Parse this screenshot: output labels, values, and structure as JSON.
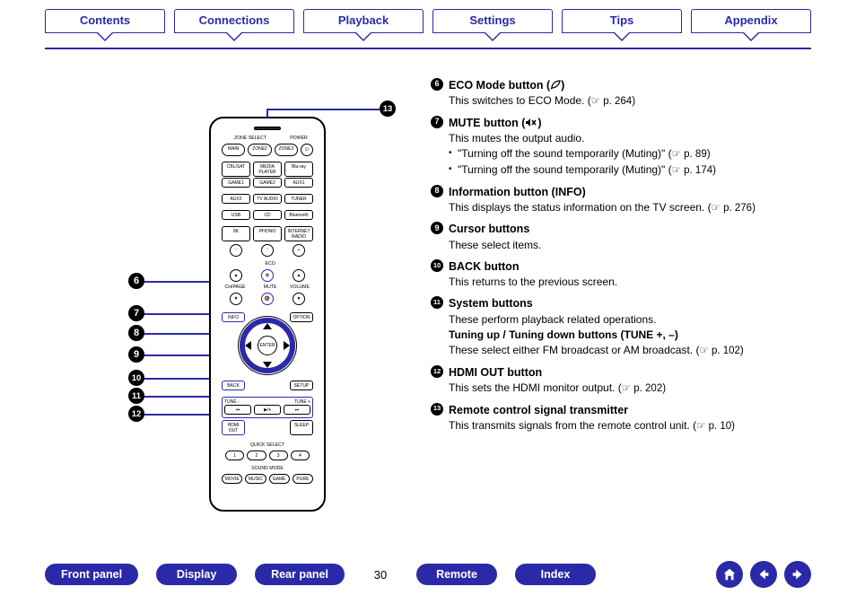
{
  "top_tabs": [
    "Contents",
    "Connections",
    "Playback",
    "Settings",
    "Tips",
    "Appendix"
  ],
  "page_number": "30",
  "callouts": {
    "n6": "6",
    "n7": "7",
    "n8": "8",
    "n9": "9",
    "n10": "10",
    "n11": "11",
    "n12": "12",
    "n13": "13"
  },
  "items": {
    "i6": {
      "title": "ECO Mode button (",
      "title_suffix": ")",
      "desc": "This switches to ECO Mode.  (",
      "pref": " p. 264)",
      "icon": "leaf"
    },
    "i7": {
      "title": "MUTE button (",
      "title_suffix": ")",
      "desc": "This mutes the output audio.",
      "sub1": "\"Turning off the sound temporarily (Muting)\" (",
      "pref1": " p. 89)",
      "sub2": "\"Turning off the sound temporarily (Muting)\" (",
      "pref2": " p. 174)",
      "icon": "mute"
    },
    "i8": {
      "title": "Information button (INFO)",
      "desc": "This displays the status information on the TV screen.  (",
      "pref": " p. 276)"
    },
    "i9": {
      "title": "Cursor buttons",
      "desc": "These select items."
    },
    "i10": {
      "title": "BACK button",
      "desc": "This returns to the previous screen."
    },
    "i11": {
      "title": "System buttons",
      "desc": "These perform playback related operations.",
      "sub_bold": "Tuning up / Tuning down buttons (TUNE +, –)",
      "sub_desc": "These select either FM broadcast or AM broadcast.  (",
      "pref": " p. 102)"
    },
    "i12": {
      "title": "HDMI OUT button",
      "desc": "This sets the HDMI monitor output.  (",
      "pref": " p. 202)"
    },
    "i13": {
      "title": "Remote control signal transmitter",
      "desc": "This transmits signals from the remote control unit.  (",
      "pref": " p. 10)"
    }
  },
  "bottom": {
    "b1": "Front panel",
    "b2": "Display",
    "b3": "Rear panel",
    "b4": "Remote",
    "b5": "Index"
  }
}
